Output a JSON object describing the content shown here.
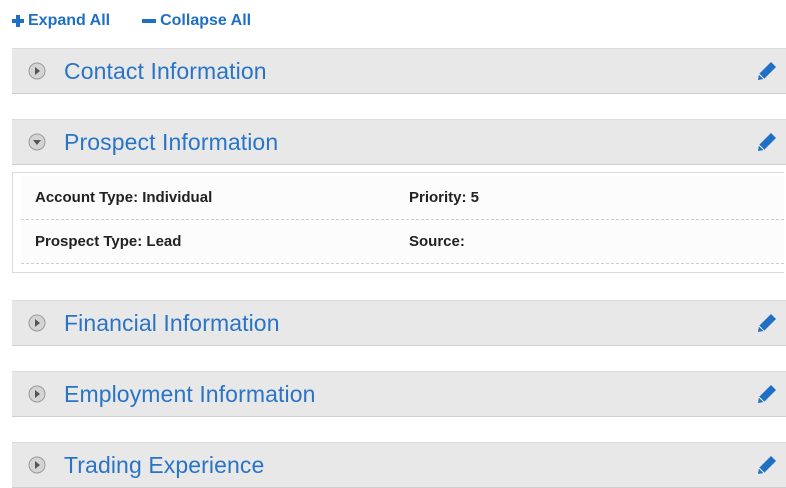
{
  "toolbar": {
    "expand_label": "Expand All",
    "collapse_label": "Collapse All"
  },
  "sections": [
    {
      "title": "Contact Information",
      "expanded": false
    },
    {
      "title": "Prospect Information",
      "expanded": true,
      "fields": [
        {
          "left": "Account Type: Individual",
          "right": "Priority: 5"
        },
        {
          "left": "Prospect Type: Lead",
          "right": "Source:"
        }
      ]
    },
    {
      "title": "Financial Information",
      "expanded": false
    },
    {
      "title": "Employment Information",
      "expanded": false
    },
    {
      "title": "Trading Experience",
      "expanded": false
    }
  ],
  "colors": {
    "accent": "#2a74c6",
    "header_bg": "#e8e8e8"
  },
  "icons": {
    "expand": "plus-icon",
    "collapse": "minus-icon",
    "toggle_collapsed": "circle-arrow-right-icon",
    "toggle_expanded": "circle-arrow-down-icon",
    "edit": "pencil-icon"
  }
}
